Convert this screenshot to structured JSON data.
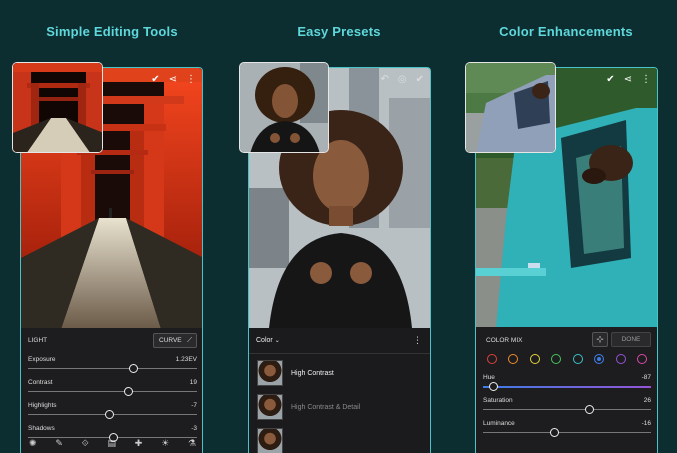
{
  "headings": {
    "left": "Simple Editing Tools",
    "center": "Easy Presets",
    "right": "Color Enhancements"
  },
  "left_panel": {
    "section": "LIGHT",
    "curve_button": "CURVE",
    "sliders": [
      {
        "label": "Exposure",
        "value": "1.23EV",
        "position": 0.62
      },
      {
        "label": "Contrast",
        "value": "19",
        "position": 0.59
      },
      {
        "label": "Highlights",
        "value": "-7",
        "position": 0.48
      },
      {
        "label": "Shadows",
        "value": "-3",
        "position": 0.5
      }
    ],
    "toolbar_icons": [
      "presets-icon",
      "brush-icon",
      "crop-icon",
      "layers-icon",
      "healing-icon",
      "light-icon",
      "color-icon"
    ]
  },
  "center_panel": {
    "dropdown": "Color",
    "presets": [
      {
        "label": "High Contrast",
        "selected": true
      },
      {
        "label": "High Contrast & Detail",
        "selected": false
      },
      {
        "label": "",
        "selected": false
      }
    ]
  },
  "right_panel": {
    "section": "COLOR MIX",
    "done_button": "DONE",
    "swatches": [
      "#e0413a",
      "#ef8a2c",
      "#e3d43a",
      "#47c35a",
      "#3bc2c9",
      "#3e7ce4",
      "#9454d6",
      "#d94aa8"
    ],
    "selected_swatch": 5,
    "sliders": [
      {
        "label": "Hue",
        "value": "-87",
        "position": 0.06
      },
      {
        "label": "Saturation",
        "value": "26",
        "position": 0.63
      },
      {
        "label": "Luminance",
        "value": "-16",
        "position": 0.42
      }
    ]
  },
  "colors": {
    "heading": "#5fd8dc",
    "frame": "#48c3c7",
    "background": "#0d2e30",
    "panel": "#1d1d1f"
  }
}
